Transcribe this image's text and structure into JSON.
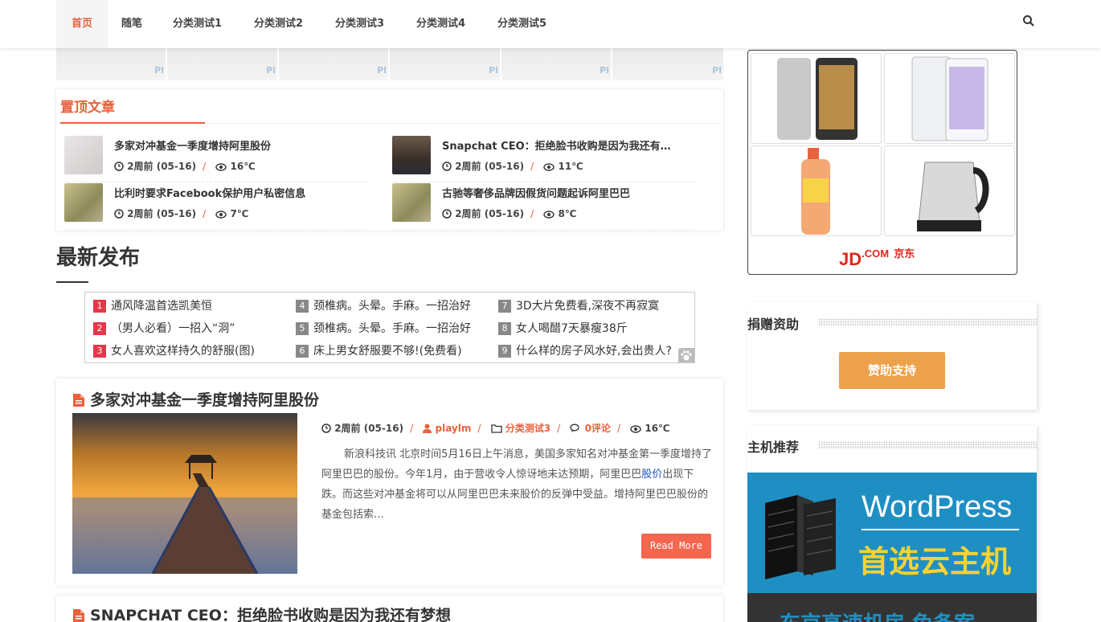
{
  "nav": {
    "items": [
      {
        "label": "首页",
        "active": true
      },
      {
        "label": "随笔"
      },
      {
        "label": "分类测试1"
      },
      {
        "label": "分类测试2"
      },
      {
        "label": "分类测试3"
      },
      {
        "label": "分类测试4"
      },
      {
        "label": "分类测试5"
      }
    ],
    "search_icon": "search-icon"
  },
  "thumb_strip": {
    "watermark": "Pl"
  },
  "sticky": {
    "title": "置顶文章",
    "posts": [
      {
        "title": "多家对冲基金一季度增持阿里股份",
        "time": "2周前 (05-16)",
        "temp": "16℃"
      },
      {
        "title": "Snapchat CEO：拒绝脸书收购是因为我还有…",
        "time": "2周前 (05-16)",
        "temp": "11℃"
      },
      {
        "title": "比利时要求Facebook保护用户私密信息",
        "time": "2周前 (05-16)",
        "temp": "7℃"
      },
      {
        "title": "古驰等奢侈品牌因假货问题起诉阿里巴巴",
        "time": "2周前 (05-16)",
        "temp": "8℃"
      }
    ]
  },
  "newest": {
    "title": "最新发布"
  },
  "ad_links": [
    {
      "num": "1",
      "text": "通风降温首选凯美恒"
    },
    {
      "num": "2",
      "text": "（男人必看）一招入“洞”"
    },
    {
      "num": "3",
      "text": "女人喜欢这样持久的舒服(图)"
    },
    {
      "num": "4",
      "text": "颈椎病。头晕。手麻。一招治好"
    },
    {
      "num": "5",
      "text": "颈椎病。头晕。手麻。一招治好"
    },
    {
      "num": "6",
      "text": "床上男女舒服要不够!(免费看)"
    },
    {
      "num": "7",
      "text": "3D大片免费看,深夜不再寂寞"
    },
    {
      "num": "8",
      "text": "女人喝醋7天暴瘦38斤"
    },
    {
      "num": "9",
      "text": "什么样的房子风水好,会出贵人?"
    }
  ],
  "posts": [
    {
      "title": "多家对冲基金一季度增持阿里股份",
      "time": "2周前 (05-16)",
      "author": "playlm",
      "category": "分类测试3",
      "comments": "0评论",
      "temp": "16℃",
      "excerpt_a": "新浪科技讯 北京时间5月16日上午消息，美国多家知名对冲基金第一季度增持了阿里巴巴的股份。今年1月，由于营收令人惊讶地未达预期，阿里巴巴",
      "excerpt_link": "股价",
      "excerpt_b": "出现下跌。而这些对冲基金将可以从阿里巴巴未来股价的反弹中受益。增持阿里巴巴股份的基金包括索…",
      "read_more": "Read More"
    },
    {
      "title": "SNAPCHAT CEO：拒绝脸书收购是因为我还有梦想"
    }
  ],
  "sidebar": {
    "jd_ad": {
      "brand": "JD",
      "brand_suffix": ".COM",
      "brand_cn": "京东"
    },
    "donate": {
      "title": "捐赠资助",
      "button": "赞助支持"
    },
    "hosting": {
      "title": "主机推荐",
      "banner_word": "WordPress",
      "banner_sub": "首选云主机",
      "banner_sub2": "东京高速机房 免备案"
    }
  },
  "colors": {
    "accent": "#e9613d",
    "donate": "#eda14b",
    "readmore": "#f4664d",
    "wp_blue": "#1f8fc3"
  }
}
